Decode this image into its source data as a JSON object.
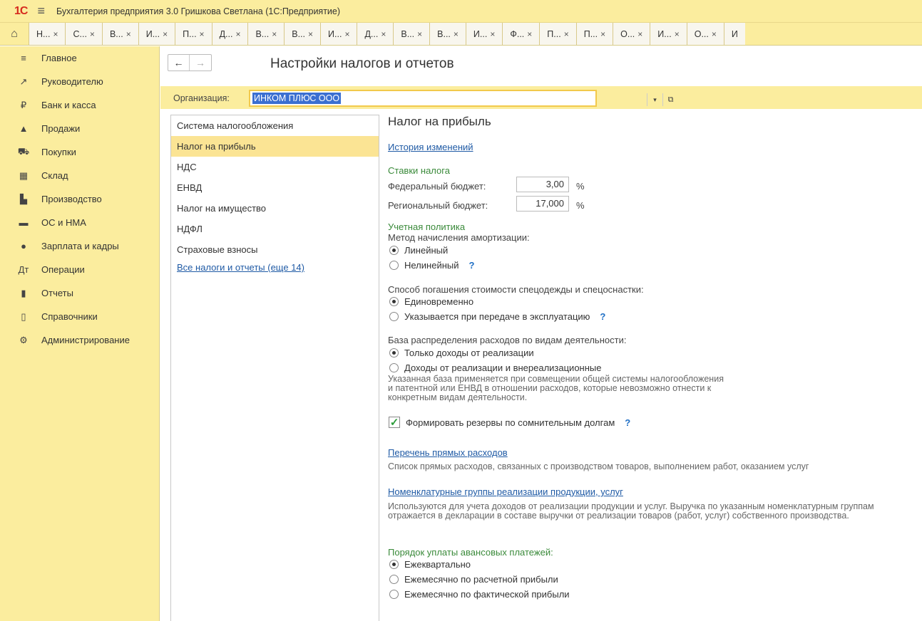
{
  "app": {
    "logo": "1С",
    "title": "Бухгалтерия предприятия 3.0 Гришкова Светлана  (1С:Предприятие)"
  },
  "tabs": [
    {
      "label": "Н..."
    },
    {
      "label": "С..."
    },
    {
      "label": "В..."
    },
    {
      "label": "И..."
    },
    {
      "label": "П..."
    },
    {
      "label": "Д..."
    },
    {
      "label": "В..."
    },
    {
      "label": "В..."
    },
    {
      "label": "И..."
    },
    {
      "label": "Д..."
    },
    {
      "label": "В..."
    },
    {
      "label": "В..."
    },
    {
      "label": "И..."
    },
    {
      "label": "Ф..."
    },
    {
      "label": "П..."
    },
    {
      "label": "П..."
    },
    {
      "label": "О..."
    },
    {
      "label": "И..."
    },
    {
      "label": "О..."
    },
    {
      "label": "И"
    }
  ],
  "sidebar": {
    "items": [
      {
        "label": "Главное",
        "icon": "≡"
      },
      {
        "label": "Руководителю",
        "icon": "↗"
      },
      {
        "label": "Банк и касса",
        "icon": "₽"
      },
      {
        "label": "Продажи",
        "icon": "▲"
      },
      {
        "label": "Покупки",
        "icon": "⛟"
      },
      {
        "label": "Склад",
        "icon": "▦"
      },
      {
        "label": "Производство",
        "icon": "▙"
      },
      {
        "label": "ОС и НМА",
        "icon": "▬"
      },
      {
        "label": "Зарплата и кадры",
        "icon": "●"
      },
      {
        "label": "Операции",
        "icon": "Дт"
      },
      {
        "label": "Отчеты",
        "icon": "▮"
      },
      {
        "label": "Справочники",
        "icon": "▯"
      },
      {
        "label": "Администрирование",
        "icon": "⚙"
      }
    ]
  },
  "header": {
    "back": "←",
    "forward": "→",
    "title": "Настройки налогов и отчетов"
  },
  "org": {
    "label": "Организация:",
    "value": "ИНКОМ ПЛЮС ООО",
    "dropdown": "▾",
    "open": "⧉"
  },
  "left_list": {
    "items": [
      {
        "label": "Система налогообложения"
      },
      {
        "label": "Налог на прибыль"
      },
      {
        "label": "НДС"
      },
      {
        "label": "ЕНВД"
      },
      {
        "label": "Налог на имущество"
      },
      {
        "label": "НДФЛ"
      },
      {
        "label": "Страховые взносы"
      }
    ],
    "all_link": "Все налоги и отчеты (еще 14)"
  },
  "content": {
    "title": "Налог на прибыль",
    "history_link": "История изменений",
    "rates": {
      "heading": "Ставки налога",
      "federal_label": "Федеральный бюджет:",
      "federal_value": "3,00",
      "regional_label": "Региональный бюджет:",
      "regional_value": "17,000",
      "percent": "%"
    },
    "policy": {
      "heading": "Учетная политика",
      "amort_label": "Метод начисления амортизации:",
      "amort_linear": "Линейный",
      "amort_nonlinear": "Нелинейный",
      "workwear_label": "Способ погашения стоимости спецодежды и спецоснастки:",
      "workwear_once": "Единовременно",
      "workwear_transfer": "Указывается при передаче в эксплуатацию",
      "base_label": "База распределения расходов по видам деятельности:",
      "base_sales": "Только доходы от реализации",
      "base_sales_nonop": "Доходы от реализации и внереализационные",
      "base_note": "Указанная база применяется при совмещении общей системы налогообложения и патентной или ЕНВД в отношении расходов, которые невозможно отнести к конкретным видам деятельности.",
      "reserves_label": "Формировать резервы по сомнительным долгам",
      "direct_link": "Перечень прямых расходов",
      "direct_note": "Список прямых расходов, связанных с производством товаров, выполнением работ, оказанием услуг",
      "nomen_link": "Номенклатурные группы реализации продукции, услуг",
      "nomen_note": "Используются для учета доходов от реализации продукции и услуг. Выручка по указанным номенклатурным группам отражается в декларации в составе выручки от реализации товаров (работ, услуг) собственного производства."
    },
    "advance": {
      "heading": "Порядок уплаты авансовых платежей:",
      "quarterly": "Ежеквартально",
      "monthly_calc": "Ежемесячно по расчетной прибыли",
      "monthly_actual": "Ежемесячно по фактической прибыли"
    },
    "help": "?"
  },
  "colors": {
    "panel_yellow": "#fbed9e",
    "active_item": "#fbe494",
    "link_blue": "#1f5aa5",
    "section_green": "#3a8a3a",
    "selection_blue": "#3b6fd1"
  }
}
